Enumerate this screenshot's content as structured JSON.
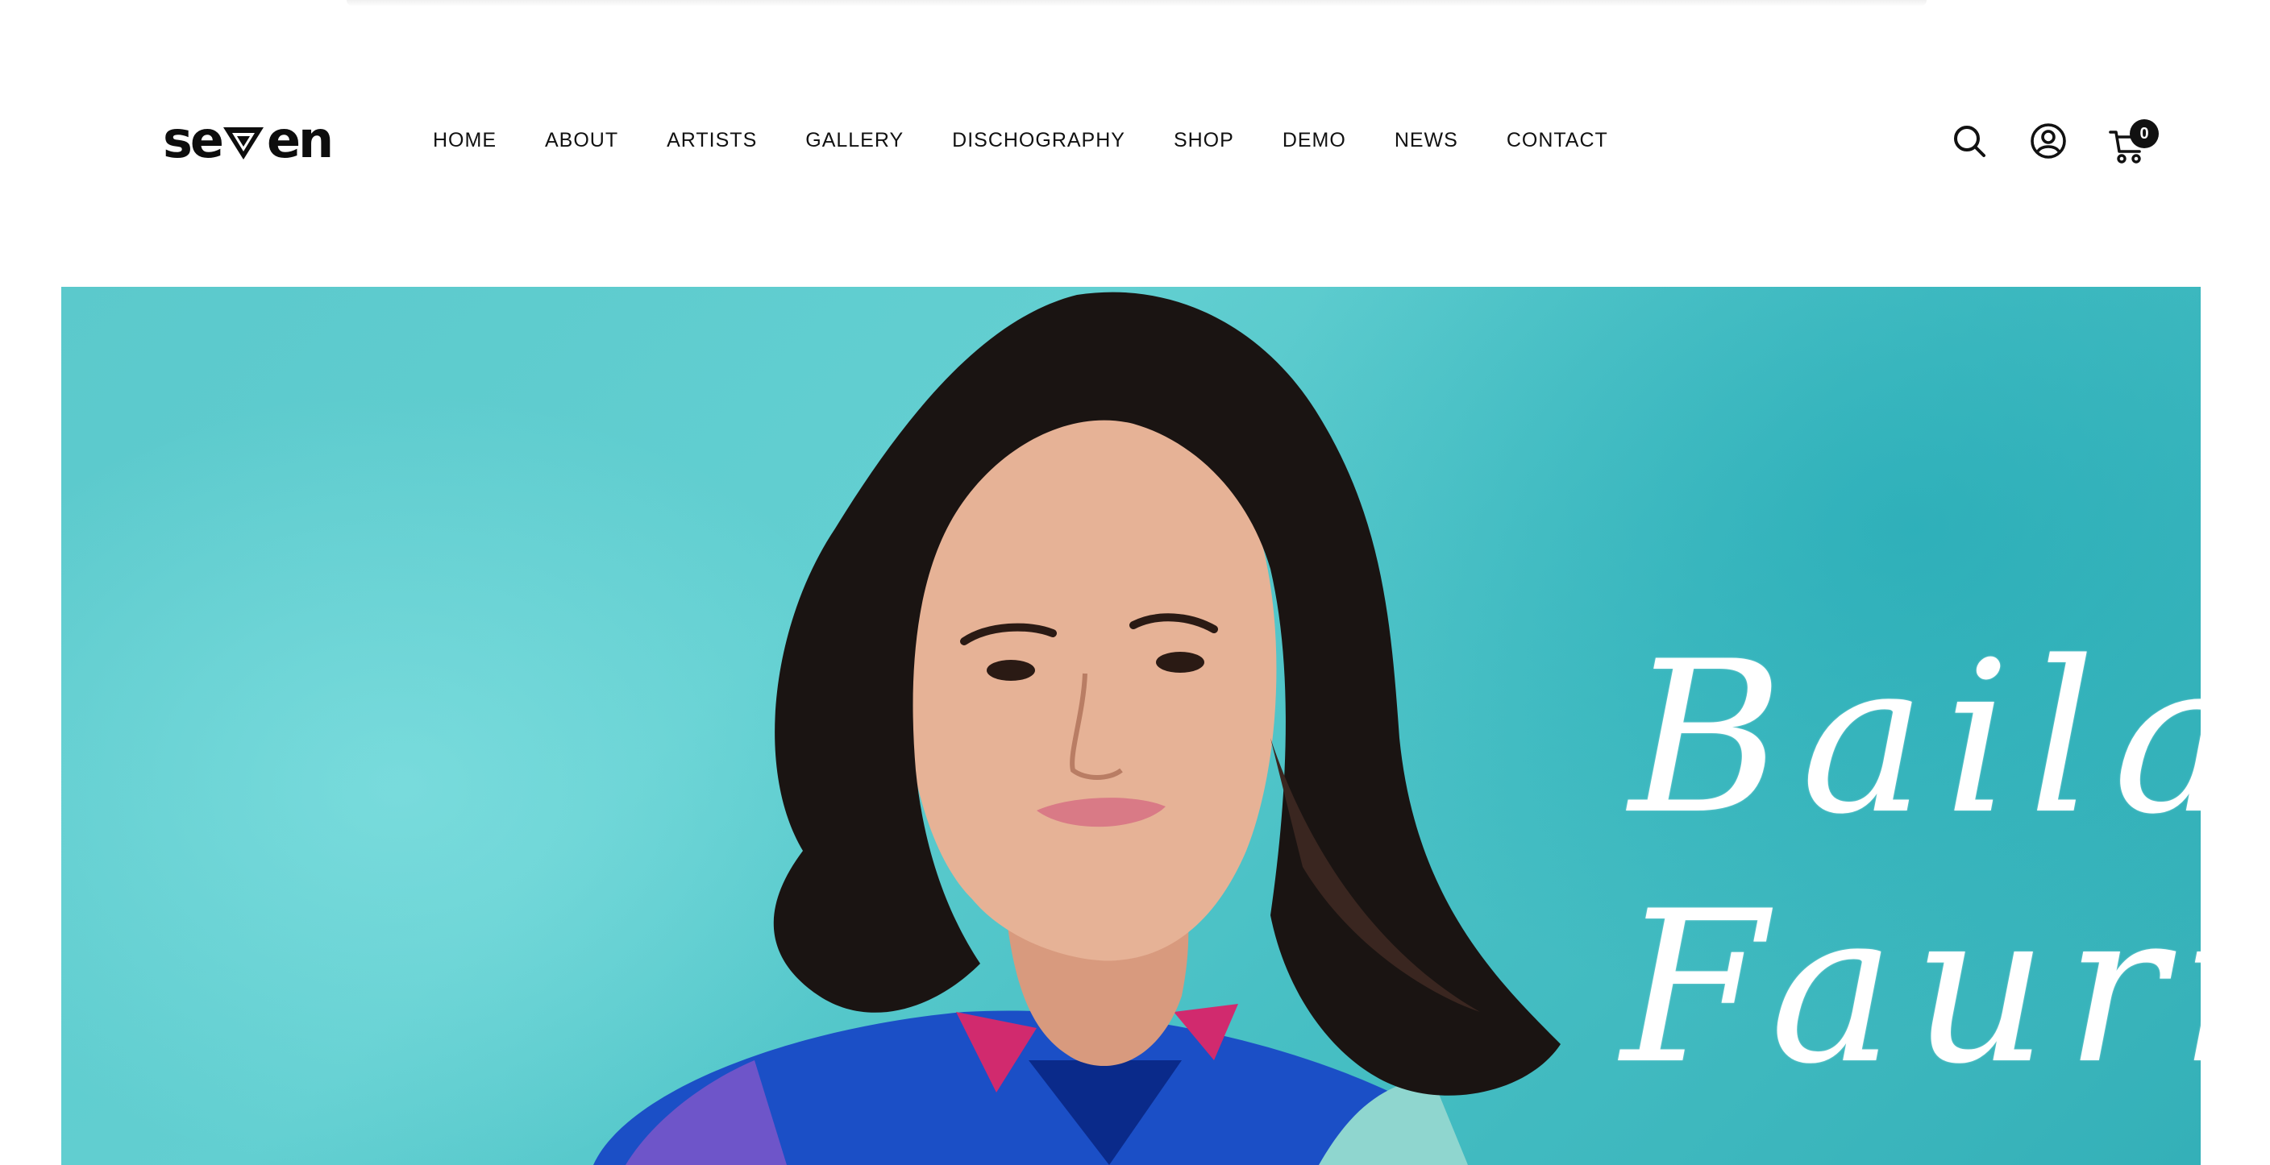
{
  "brand": {
    "logo_left": "se",
    "logo_right": "en"
  },
  "nav": {
    "items": [
      {
        "label": "HOME"
      },
      {
        "label": "ABOUT"
      },
      {
        "label": "ARTISTS"
      },
      {
        "label": "GALLERY"
      },
      {
        "label": "DISCHOGRAPHY"
      },
      {
        "label": "SHOP"
      },
      {
        "label": "DEMO"
      },
      {
        "label": "NEWS"
      },
      {
        "label": "CONTACT"
      }
    ]
  },
  "actions": {
    "search_icon": "search-icon",
    "account_icon": "user-circle-icon",
    "cart_icon": "cart-icon",
    "cart_count": "0"
  },
  "hero": {
    "line1": "Baila",
    "line2": "Fauri"
  },
  "colors": {
    "hero_bg": "#5bc9cc",
    "text_dark": "#111111",
    "badge_bg": "#111111"
  }
}
